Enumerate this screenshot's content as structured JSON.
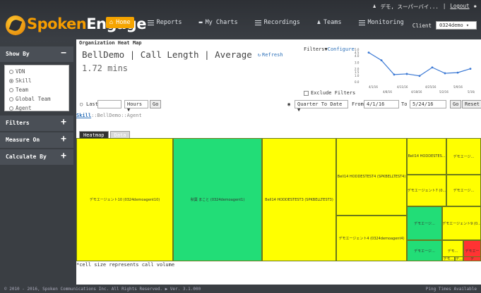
{
  "app": {
    "brand_a": "Spoken",
    "brand_b": "Engage",
    "nav": [
      {
        "label": "Home",
        "icon": "home-icon",
        "active": true
      },
      {
        "label": "Reports",
        "icon": "list-icon"
      },
      {
        "label": "My Charts",
        "icon": "folder-icon"
      },
      {
        "label": "Recordings",
        "icon": "list-icon"
      },
      {
        "label": "Teams",
        "icon": "user-icon"
      },
      {
        "label": "Monitoring",
        "icon": "list-icon"
      }
    ],
    "user_name": "デモ, スーパーバイ...",
    "logout": "Logout",
    "client_label": "Client",
    "client_value": "0324demo"
  },
  "sidebar": {
    "showby_title": "Show By",
    "showby_options": [
      {
        "label": "VDN",
        "checked": false
      },
      {
        "label": "Skill",
        "checked": true
      },
      {
        "label": "Team",
        "checked": false
      },
      {
        "label": "Global Team",
        "checked": false
      },
      {
        "label": "Agent",
        "checked": false
      }
    ],
    "filters_title": "Filters",
    "measure_title": "Measure On",
    "calculate_title": "Calculate By"
  },
  "panel": {
    "title": "Organization Heat Map",
    "heading": "BellDemo | Call Length | Average",
    "refresh": "Refresh",
    "average_value": "1.72 mins",
    "filters_label": "Filters",
    "configure": "Configure",
    "exclude_filters": "Exclude Filters"
  },
  "chart_data": {
    "type": "line",
    "x": [
      "4/1/16",
      "4/8/16",
      "4/11/16",
      "4/18/16",
      "4/25/16",
      "5/2/16",
      "5/9/16",
      "5/16/16"
    ],
    "values": [
      4.5,
      3.3,
      1.1,
      1.2,
      0.9,
      2.2,
      1.3,
      1.4,
      2.0
    ],
    "ylim": [
      0,
      5
    ],
    "ytick_labels": [
      "0.0",
      "1.0",
      "1.5",
      "2.0",
      "3.0",
      "4.0",
      "4.5",
      "5.0"
    ],
    "xtick_labels_top": [
      "4/1/16",
      "4/11/16",
      "4/25/16",
      "5/9/16"
    ],
    "xtick_labels_bottom": [
      "4/8/16",
      "4/18/16",
      "5/2/16",
      "5/16/16"
    ],
    "color": "#3a78d4"
  },
  "daterow": {
    "last_label": "Last",
    "last_value": "",
    "unit_value": "Hours ▼",
    "go1": "Go",
    "quarter_value": "Quarter To Date",
    "from_label": "From",
    "from_value": "4/1/16",
    "to_label": "To",
    "to_value": "5/24/16",
    "go2": "Go",
    "reset": "Reset"
  },
  "breadcrumb": {
    "first": "Skill",
    "rest": "::BellDemo::Agent"
  },
  "tabs": {
    "heatmap": "Heatmap",
    "data": "Data"
  },
  "treemap": [
    {
      "label": "デモエージェント10 (0324demoagent10)",
      "color": "#ffff00"
    },
    {
      "label": "秋葉 まこと (0324demoagent1)",
      "color": "#22dd77"
    },
    {
      "label": "Bell14 HODDESTEST3 (SPKBELLTEST3)",
      "color": "#ffff00"
    },
    {
      "label": "Bell14 HODDESTEST4 (SPKBELLTEST4)",
      "color": "#ffff00"
    },
    {
      "label": "デモエージェント4 (0324demoagent4)",
      "color": "#ffff00"
    },
    {
      "label": "Bell14 HODDESTES...",
      "color": "#ffff00"
    },
    {
      "label": "デモエージ...",
      "color": "#ffff00"
    },
    {
      "label": "デモエージェント7 (0...",
      "color": "#ffff00"
    },
    {
      "label": "デモエージ...",
      "color": "#ffff00"
    },
    {
      "label": "デモエージ...",
      "color": "#22dd77"
    },
    {
      "label": "デモエージェント9 (0...",
      "color": "#ffff00"
    },
    {
      "label": "デモエージ...",
      "color": "#22dd77"
    },
    {
      "label": "デモ...",
      "color": "#ffff00"
    },
    {
      "label": "デモエー",
      "color": "#ff3333"
    },
    {
      "label": "デモ...",
      "color": "#ffff00"
    },
    {
      "label": "デ...",
      "color": "#ffff00"
    },
    {
      "label": "デ",
      "color": "#ff3333"
    }
  ],
  "footnote": "*cell size represents call volume",
  "footer": "© 2010 - 2016, Spoken Communications Inc. All Rights Reserved. ▶ Ver. 3.1.000",
  "footer_right": "Ping Times Available"
}
